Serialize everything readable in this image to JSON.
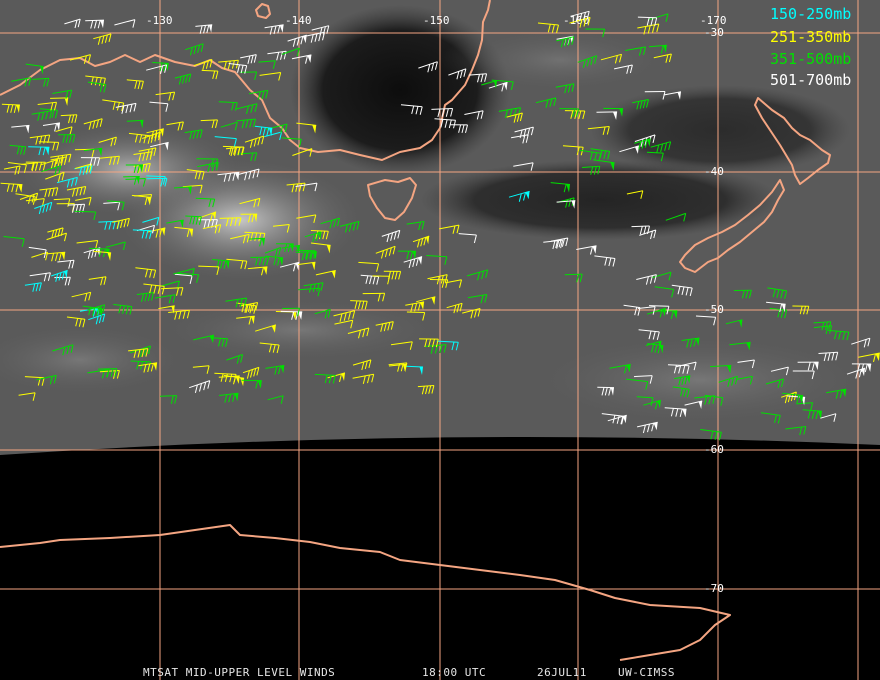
{
  "map": {
    "longitude_labels": [
      "-130",
      "-140",
      "-150",
      "-160",
      "-170"
    ],
    "latitude_labels": [
      "-30",
      "-40",
      "-50",
      "-60",
      "-70"
    ],
    "graticule_color": "#f4a582",
    "coastline_color": "#f4a582"
  },
  "legend": [
    {
      "label": "150-250mb",
      "color": "#00ffff"
    },
    {
      "label": "251-350mb",
      "color": "#ffff00"
    },
    {
      "label": "351-500mb",
      "color": "#00e000"
    },
    {
      "label": "501-700mb",
      "color": "#ffffff"
    }
  ],
  "footer": {
    "product": "MTSAT MID-UPPER LEVEL WINDS",
    "time": "18:00 UTC",
    "date": "26JUL11",
    "source": "UW-CIMSS"
  }
}
